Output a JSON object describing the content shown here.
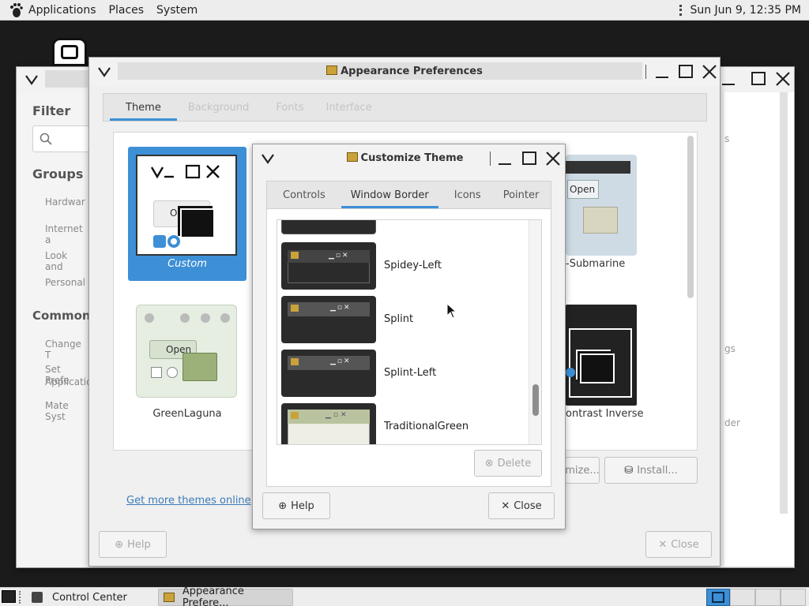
{
  "top_panel": {
    "menus": [
      "Applications",
      "Places",
      "System"
    ],
    "clock": "Sun Jun  9, 12:35 PM"
  },
  "control_center": {
    "filter_label": "Filter",
    "groups_label": "Groups",
    "groups": [
      "Hardwar",
      "Internet a",
      "Look and",
      "Personal"
    ],
    "common_label": "Common T",
    "common_items": [
      "Change T",
      "Set Prefe",
      "Applicatio",
      "Mate Syst"
    ],
    "right_fragments": [
      "s",
      "gs",
      "der"
    ]
  },
  "appearance": {
    "title": "Appearance Preferences",
    "tabs": [
      "Theme",
      "Background",
      "Fonts",
      "Interface"
    ],
    "themes": {
      "custom": "Custom",
      "green_laguna": "GreenLaguna",
      "submarine": "-Submarine",
      "contrast_inverse": "ontrast Inverse"
    },
    "preview_open": "Open",
    "preview_open_partial": "Ope",
    "buttons": {
      "customize": "mize...",
      "install": "Install...",
      "help": "Help",
      "close": "Close"
    },
    "link": "Get more themes online"
  },
  "customize": {
    "title": "Customize Theme",
    "tabs": [
      "Controls",
      "Window Border",
      "Icons",
      "Pointer"
    ],
    "items": [
      "Spidey-Left",
      "Splint",
      "Splint-Left",
      "TraditionalGreen"
    ],
    "delete": "Delete",
    "help": "Help",
    "close": "Close"
  },
  "taskbar": {
    "tasks": [
      "Control Center",
      "Appearance Prefere..."
    ]
  },
  "colors": {
    "accent": "#3d8fd6",
    "panel": "#ededed",
    "desktop": "#1b1b1b"
  }
}
